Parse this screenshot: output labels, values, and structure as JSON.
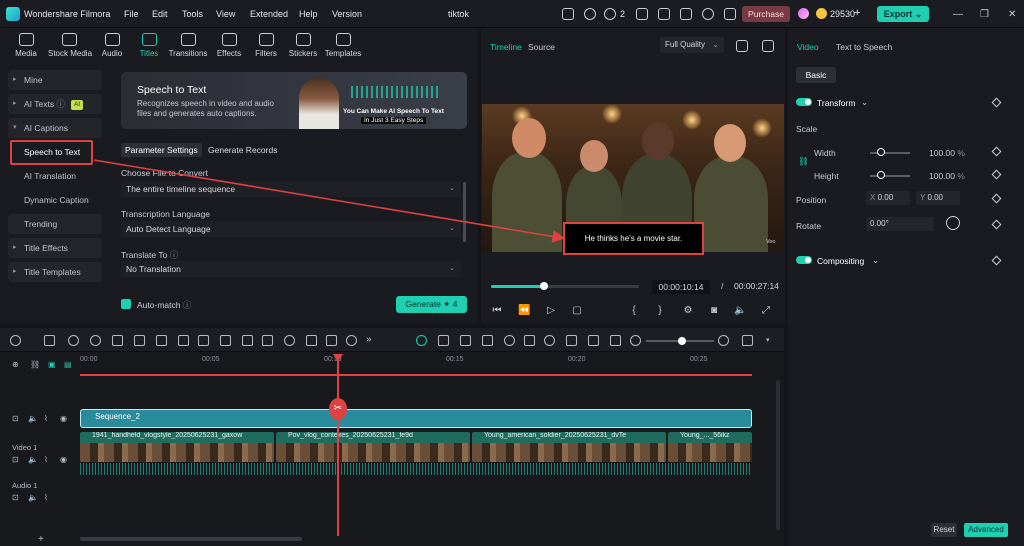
{
  "app": {
    "title": "Wondershare Filmora",
    "project": "tiktok"
  },
  "menu": [
    "File",
    "Edit",
    "Tools",
    "View",
    "Extended",
    "Help",
    "Version"
  ],
  "titlebar": {
    "notif_count": "2",
    "purchase": "Purchase",
    "credits": "29530",
    "add": "+",
    "export": "Export",
    "export_chev": "⌄"
  },
  "toolbar_tabs": [
    {
      "label": "Media",
      "icon": "media-icon"
    },
    {
      "label": "Stock Media",
      "icon": "stock-media-icon"
    },
    {
      "label": "Audio",
      "icon": "audio-icon"
    },
    {
      "label": "Titles",
      "icon": "titles-icon"
    },
    {
      "label": "Transitions",
      "icon": "transitions-icon"
    },
    {
      "label": "Effects",
      "icon": "effects-icon"
    },
    {
      "label": "Filters",
      "icon": "filters-icon"
    },
    {
      "label": "Stickers",
      "icon": "stickers-icon"
    },
    {
      "label": "Templates",
      "icon": "templates-icon"
    }
  ],
  "sidebar": {
    "items": [
      {
        "label": "Mine"
      },
      {
        "label": "AI Texts",
        "badge": "AI"
      },
      {
        "label": "AI Captions"
      },
      {
        "label": "Speech to Text"
      },
      {
        "label": "AI Translation"
      },
      {
        "label": "Dynamic Caption"
      },
      {
        "label": "Trending"
      },
      {
        "label": "Title Effects"
      },
      {
        "label": "Title Templates"
      }
    ]
  },
  "banner": {
    "title": "Speech to Text",
    "desc": "Recognizes speech in video and audio files and generates auto captions.",
    "line1": "You Can Make AI Speech To Text",
    "line2": "In Just  3 Easy Steps"
  },
  "panel_tabs": [
    "Parameter Settings",
    "Generate Records"
  ],
  "form": {
    "file_label": "Choose File to Convert",
    "file_value": "The entire timeline sequence",
    "lang_label": "Transcription Language",
    "lang_value": "Auto Detect Language",
    "translate_label": "Translate To",
    "translate_value": "No Translation",
    "auto_match": "Auto-match",
    "generate": "Generate",
    "generate_count": "4"
  },
  "player": {
    "tabs": [
      "Timeline",
      "Source"
    ],
    "quality": "Full Quality",
    "caption": "He thinks he's a movie star.",
    "watermark": "Veo",
    "current": "00:00:10:14",
    "separator": "/",
    "total": "00:00:27:14",
    "progress": 0.36
  },
  "properties": {
    "tabs": [
      "Video",
      "Text to Speech"
    ],
    "basic": "Basic",
    "transform": "Transform",
    "scale": "Scale",
    "width": "Width",
    "width_val": "100.00",
    "height": "Height",
    "height_val": "100.00",
    "unit": "%",
    "position": "Position",
    "x_label": "X",
    "x_val": "0.00",
    "y_label": "Y",
    "y_val": "0.00",
    "rotate": "Rotate",
    "rotate_val": "0.00°",
    "compositing": "Compositing",
    "reset": "Reset",
    "advanced": "Advanced"
  },
  "timeline": {
    "ruler": [
      "00:00",
      "00:05",
      "00:10",
      "00:15",
      "00:20",
      "00:25"
    ],
    "sequence": "Sequence_2",
    "clips": [
      "1941_handheld_vlogstyle_20250625231_gaxow",
      "Pov_vlog_contexes_20250625231_fe9d",
      "Young_american_soldier_20250625231_dvTe",
      "Young_..._56ikz"
    ],
    "video_track": "Video 1",
    "audio_track": "Audio 1",
    "add": "+"
  },
  "colors": {
    "accent": "#1ecfb1",
    "highlight": "#e04141",
    "purchase": "#7a3a44",
    "sequence": "#2a8b9c",
    "clip": "#1f6c5f"
  }
}
